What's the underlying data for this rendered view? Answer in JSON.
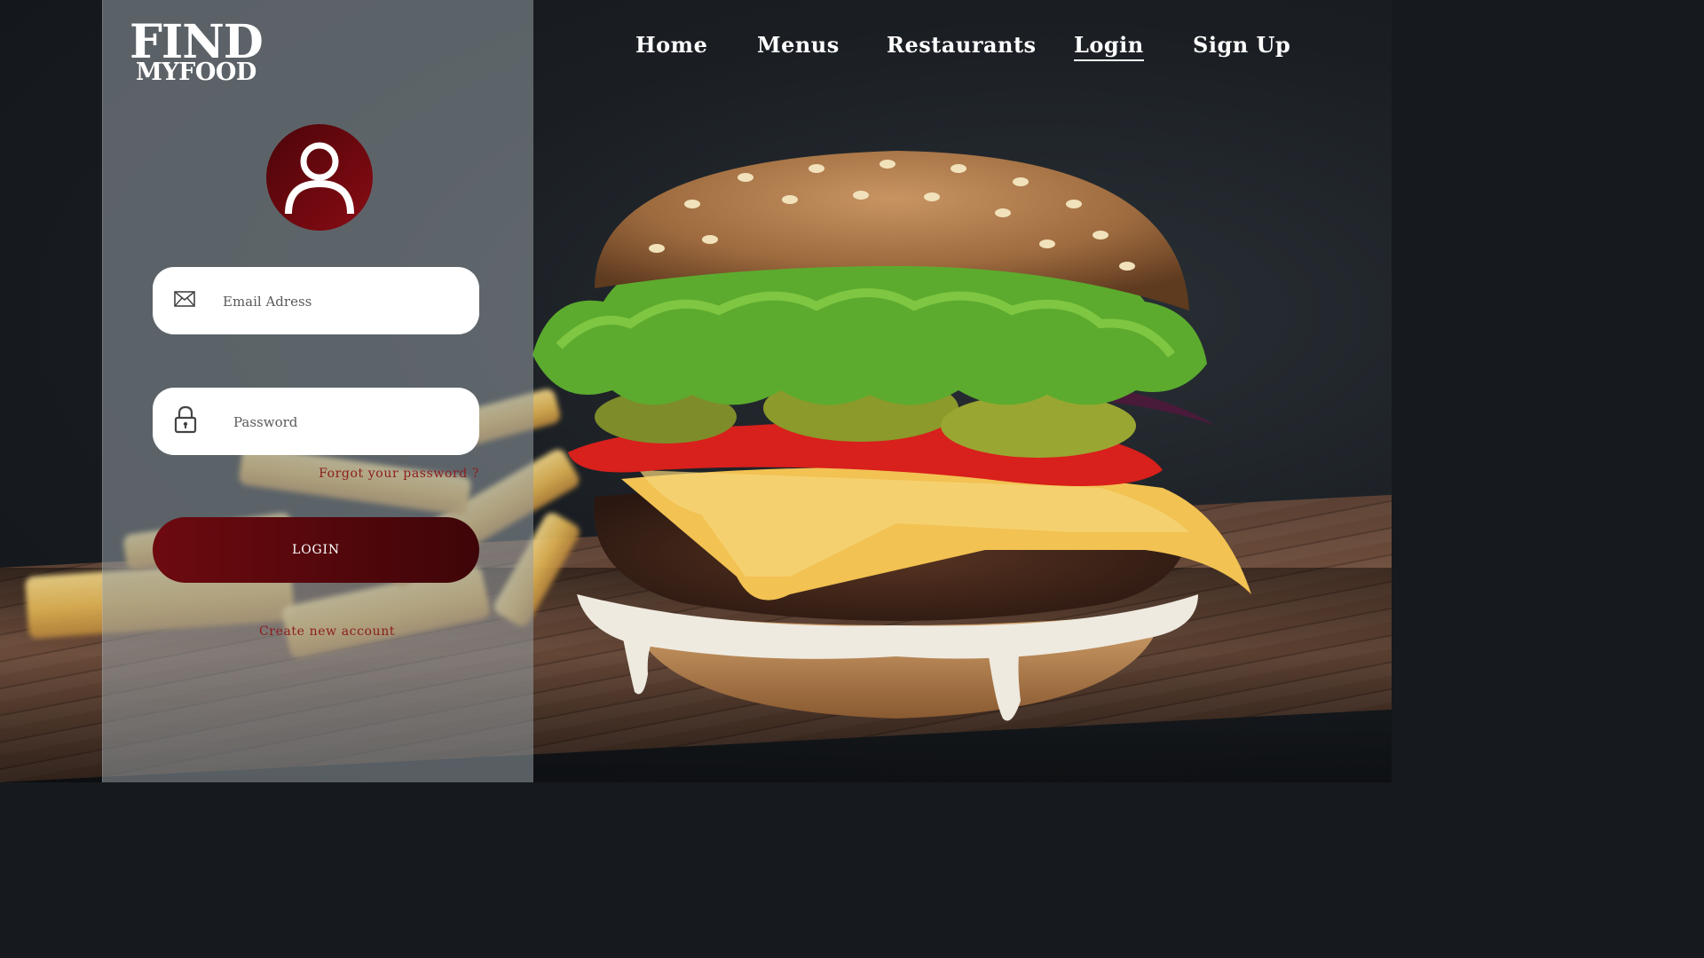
{
  "brand": {
    "line1": "FIND",
    "line2": "MYFOOD"
  },
  "nav": {
    "home": "Home",
    "menus": "Menus",
    "restaurants": "Restaurants",
    "login": "Login",
    "signup": "Sign Up",
    "active": "Login"
  },
  "form": {
    "email_placeholder": "Email Adress",
    "email_value": "",
    "password_placeholder": "Password",
    "password_value": "",
    "forgot_label": "Forgot your password ?",
    "login_label": "LOGIN",
    "create_label": "Create new account"
  },
  "icons": {
    "avatar": "user-icon",
    "email": "envelope-icon",
    "password": "lock-icon"
  },
  "colors": {
    "accent_dark": "#3e0508",
    "accent": "#6d0a10",
    "link": "#8c1c1c",
    "panel": "rgba(150,158,164,0.55)"
  }
}
